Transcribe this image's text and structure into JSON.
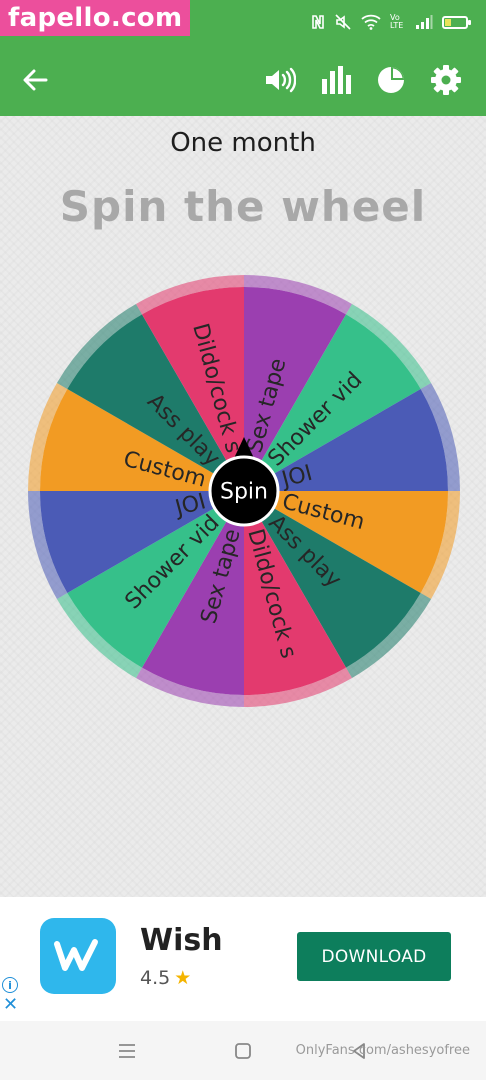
{
  "watermark": "fapello.com",
  "status_bar": {
    "icons": [
      "nfc-icon",
      "mute-icon",
      "wifi-icon",
      "volte-icon",
      "signal-icon",
      "battery-icon"
    ],
    "volte_label": "Vo LTE",
    "battery_level": 0.25
  },
  "app_bar": {
    "icons": [
      "back-arrow-icon",
      "sound-icon",
      "stats-icon",
      "pie-chart-icon",
      "settings-icon"
    ]
  },
  "subtitle": "One month",
  "title": "Spin the wheel",
  "wheel": {
    "center_label": "Spin",
    "segments": [
      {
        "label": "Sex tape",
        "color": "#9b3fb0"
      },
      {
        "label": "Shower vid",
        "color": "#36c08a"
      },
      {
        "label": "JOI",
        "color": "#4b5bb6"
      },
      {
        "label": "Custom",
        "color": "#f29b23"
      },
      {
        "label": "Ass play",
        "color": "#1e7b6a"
      },
      {
        "label": "Dildo/cock s",
        "color": "#e33a6e"
      },
      {
        "label": "Sex tape",
        "color": "#9b3fb0"
      },
      {
        "label": "Shower vid",
        "color": "#36c08a"
      },
      {
        "label": "JOI",
        "color": "#4b5bb6"
      },
      {
        "label": "Custom",
        "color": "#f29b23"
      },
      {
        "label": "Ass play",
        "color": "#1e7b6a"
      },
      {
        "label": "Dildo/cock s",
        "color": "#e33a6e"
      }
    ]
  },
  "ad": {
    "app_name": "Wish",
    "rating": "4.5",
    "rating_star": "★",
    "cta": "DOWNLOAD",
    "info_label": "i",
    "close_label": "✕"
  },
  "nav_bar": {
    "credit": "OnlyFans.com/ashesyofree"
  }
}
